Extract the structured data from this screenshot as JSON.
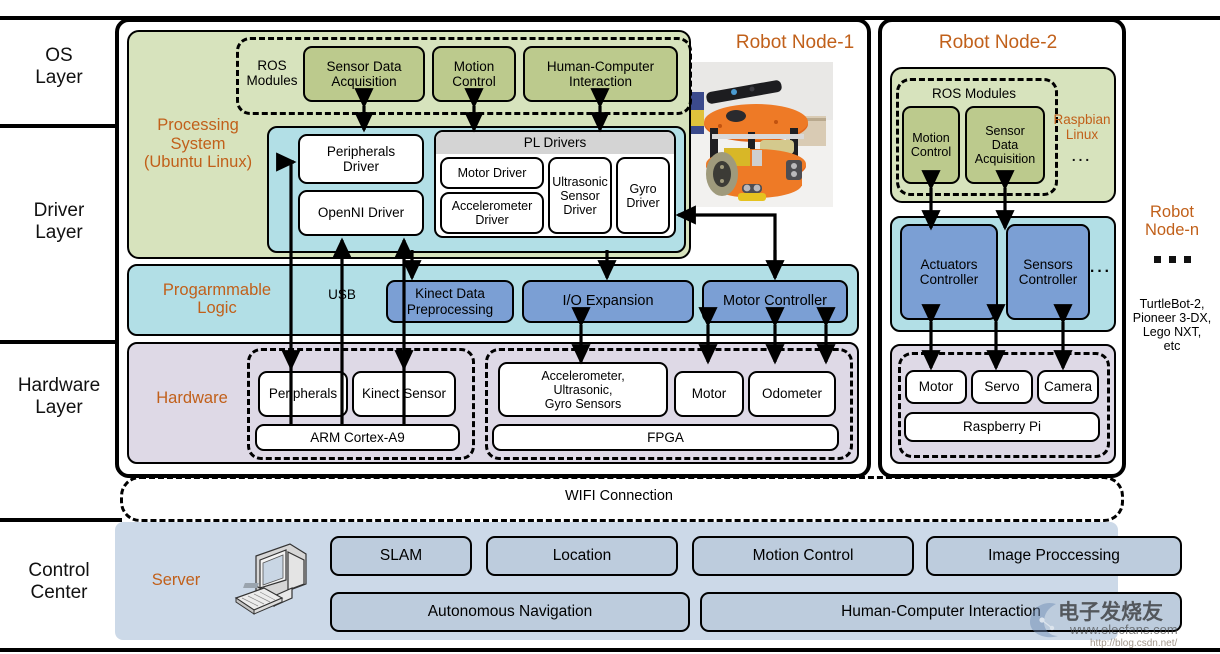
{
  "layers": [
    {
      "id": "os",
      "label": "OS\nLayer"
    },
    {
      "id": "driver",
      "label": "Driver\nLayer"
    },
    {
      "id": "hardware",
      "label": "Hardware\nLayer"
    },
    {
      "id": "control",
      "label": "Control\nCenter"
    }
  ],
  "layer_labels": {
    "os_line1": "OS",
    "os_line2": "Layer",
    "driver_line1": "Driver",
    "driver_line2": "Layer",
    "hw_line1": "Hardware",
    "hw_line2": "Layer",
    "cc_line1": "Control",
    "cc_line2": "Center"
  },
  "node1": {
    "title": "Robot Node-1",
    "processing_system": {
      "line1": "Processing",
      "line2": "System",
      "line3": "(Ubuntu Linux)"
    },
    "ros_modules_label": "ROS\nModules",
    "ros_modules_label_l1": "ROS",
    "ros_modules_label_l2": "Modules",
    "ros_modules": [
      {
        "line1": "Sensor Data",
        "line2": "Acquisition"
      },
      {
        "line1": "Motion",
        "line2": "Control"
      },
      {
        "line1": "Human-Computer",
        "line2": "Interaction"
      }
    ],
    "drivers_left": [
      {
        "line1": "Peripherals",
        "line2": "Driver"
      },
      {
        "line1": "OpenNI Driver",
        "line2": ""
      }
    ],
    "pl_drivers_title": "PL Drivers",
    "pl_drivers": [
      {
        "line1": "Motor Driver",
        "line2": ""
      },
      {
        "line1": "Accelerometer",
        "line2": "Driver"
      },
      {
        "line1": "Ultrasonic",
        "line2": "Sensor",
        "line3": "Driver"
      },
      {
        "line1": "Gyro",
        "line2": "Driver"
      }
    ],
    "programmable_logic": {
      "line1": "Progarmmable",
      "line2": "Logic"
    },
    "usb_label": "USB",
    "pl_blocks": [
      {
        "line1": "Kinect Data",
        "line2": "Preprocessing"
      },
      {
        "line1": "I/O Expansion",
        "line2": ""
      },
      {
        "line1": "Motor Controller",
        "line2": ""
      }
    ],
    "hardware_label": "Hardware",
    "hw_left_boxes": [
      {
        "line1": "Peripherals"
      },
      {
        "line1": "Kinect Sensor"
      }
    ],
    "hw_left_base": "ARM Cortex-A9",
    "hw_right_boxes": [
      {
        "line1": "Accelerometer,",
        "line2": "Ultrasonic,",
        "line3": "Gyro Sensors"
      },
      {
        "line1": "Motor"
      },
      {
        "line1": "Odometer"
      }
    ],
    "hw_right_base": "FPGA"
  },
  "node2": {
    "title": "Robot Node-2",
    "ros_modules_title": "ROS Modules",
    "os_name": {
      "line1": "Raspbian",
      "line2": "Linux",
      "dots": "..."
    },
    "ros_modules": [
      {
        "line1": "Motion",
        "line2": "Control"
      },
      {
        "line1": "Sensor",
        "line2": "Data",
        "line3": "Acquisition"
      }
    ],
    "controllers": [
      {
        "line1": "Actuators",
        "line2": "Controller"
      },
      {
        "line1": "Sensors",
        "line2": "Controller"
      }
    ],
    "controllers_dots": "...",
    "hw_boxes": [
      {
        "line1": "Motor"
      },
      {
        "line1": "Servo"
      },
      {
        "line1": "Camera"
      }
    ],
    "hw_base": "Raspberry Pi"
  },
  "noden": {
    "title_line1": "Robot",
    "title_line2": "Node-n",
    "examples_line1": "TurtleBot-2,",
    "examples_line2": "Pioneer 3-DX,",
    "examples_line3": "Lego NXT,",
    "examples_line4": "etc"
  },
  "wifi": {
    "label": "WIFI Connection"
  },
  "control_center": {
    "server_label": "Server",
    "row1": [
      "SLAM",
      "Location",
      "Motion Control",
      "Image Proccessing"
    ],
    "row2": [
      "Autonomous Navigation",
      "Human-Computer Interaction"
    ]
  },
  "watermark": {
    "cn": "电子发烧友",
    "url": "www.elecfans.com",
    "sub": "http://blog.csdn.net/"
  },
  "colors": {
    "os_band": "#d7e3bd",
    "os_box": "#bcca8d",
    "pl_band": "#b2dfe6",
    "pl_box": "#7b9fd4",
    "hw_band": "#ded9e6",
    "cc_band": "#ccd9e8",
    "cc_box": "#bdccdd",
    "accent": "#c1601a",
    "stroke": "#000000"
  }
}
